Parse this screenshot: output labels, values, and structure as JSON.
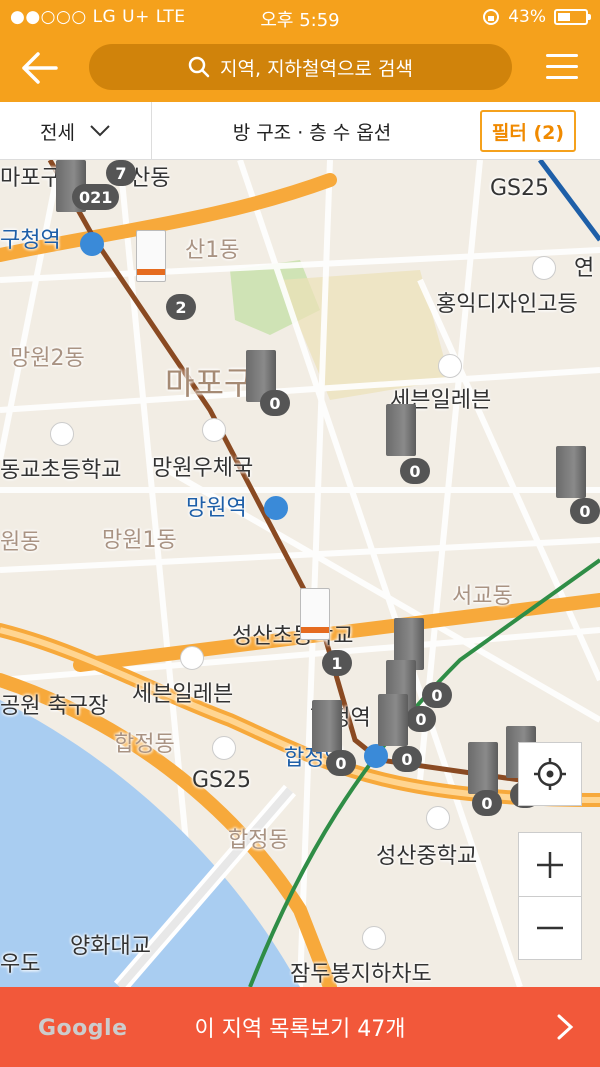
{
  "status_bar": {
    "carrier": "●●○○○ LG U+  LTE",
    "time": "오후 5:59",
    "battery": "43%"
  },
  "header": {
    "search_placeholder": "지역, 지하철역으로 검색"
  },
  "filter_bar": {
    "deal_type": "전세",
    "options_label": "방 구조 · 층 수 옵션",
    "filter_label": "필터 (2)"
  },
  "map": {
    "labels": {
      "mapo_gu_top": "마포구",
      "sandong": "산동",
      "seongsan1_top": "성산1동",
      "gs25_top": "GS25",
      "gucheong_station": "구청역",
      "seongsan1": "산1동",
      "yeon": "연",
      "hongik_design": "홍익디자인고등",
      "mangwon2": "망원2동",
      "mapo_gu": "마포구",
      "seven_eleven_top": "세븐일레븐",
      "donggyo_school": "동교초등학교",
      "mangwon_post": "망원우체국",
      "mangwon_station": "망원역",
      "wondong": "원동",
      "mangwon1": "망원1동",
      "seogyo": "서교동",
      "seongsan_school": "성산초등학교",
      "park_stadium": "공원 축구장",
      "seven_eleven": "세븐일레븐",
      "hapjeong_station": "합정역",
      "hapjeong_station2": "합정역",
      "hapjeong_area": "합정동",
      "gs25": "GS25",
      "hapjeong_dong": "합정동",
      "seongsan_middle": "성산중학교",
      "yanghwa_bridge": "양화대교",
      "udo": "우도",
      "jamdubong": "잠두봉지하차도",
      "google": "Google"
    },
    "markers": [
      {
        "count": "7"
      },
      {
        "count": "021"
      },
      {
        "count": "2"
      },
      {
        "count": "0"
      },
      {
        "count": "0"
      },
      {
        "count": "0"
      },
      {
        "count": "1"
      },
      {
        "count": "0"
      },
      {
        "count": "0"
      },
      {
        "count": "0"
      },
      {
        "count": "0"
      },
      {
        "count": "0"
      },
      {
        "count": "0"
      }
    ]
  },
  "bottom_bar": {
    "label": "이 지역 목록보기 47개"
  },
  "colors": {
    "brand_orange": "#f5a11c",
    "bottom_red": "#f2583a",
    "map_bg": "#f2ede4",
    "water": "#a9cdf1",
    "road_major": "#f7a93b",
    "subway_line2": "#2f8d46",
    "subway_line6": "#8a4a22"
  }
}
